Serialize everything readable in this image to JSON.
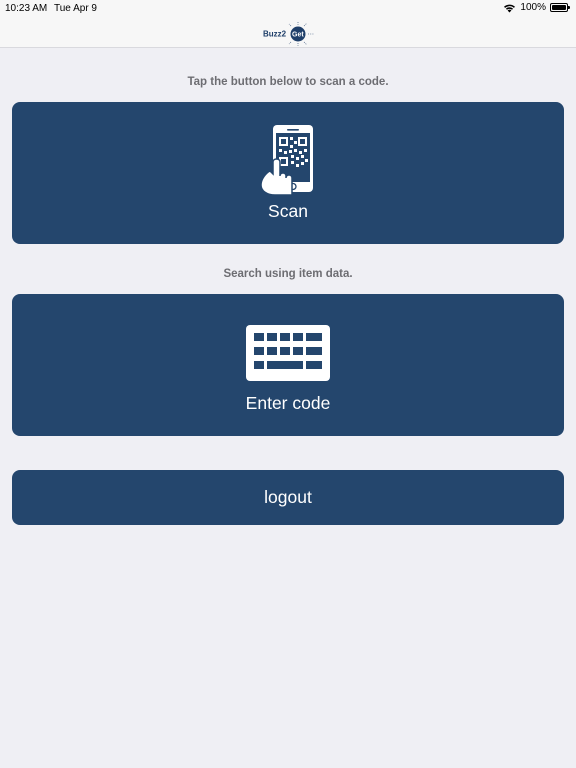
{
  "status": {
    "time": "10:23 AM",
    "date": "Tue Apr 9",
    "battery": "100%",
    "battery_level": 1.0,
    "wifi_icon": "wifi-icon"
  },
  "header": {
    "logo_text": "Buzz2Get"
  },
  "main": {
    "scan_prompt": "Tap the button below to scan a code.",
    "scan_label": "Scan",
    "scan_icon": "qr-phone-icon",
    "search_prompt": "Search using item data.",
    "enter_code_label": "Enter code",
    "keyboard_icon": "keyboard-icon",
    "logout_label": "logout"
  },
  "colors": {
    "button_bg": "#24466d",
    "background": "#efeff4",
    "prompt_text": "#6d6d72",
    "logo_accent": "#1f3f6a"
  }
}
